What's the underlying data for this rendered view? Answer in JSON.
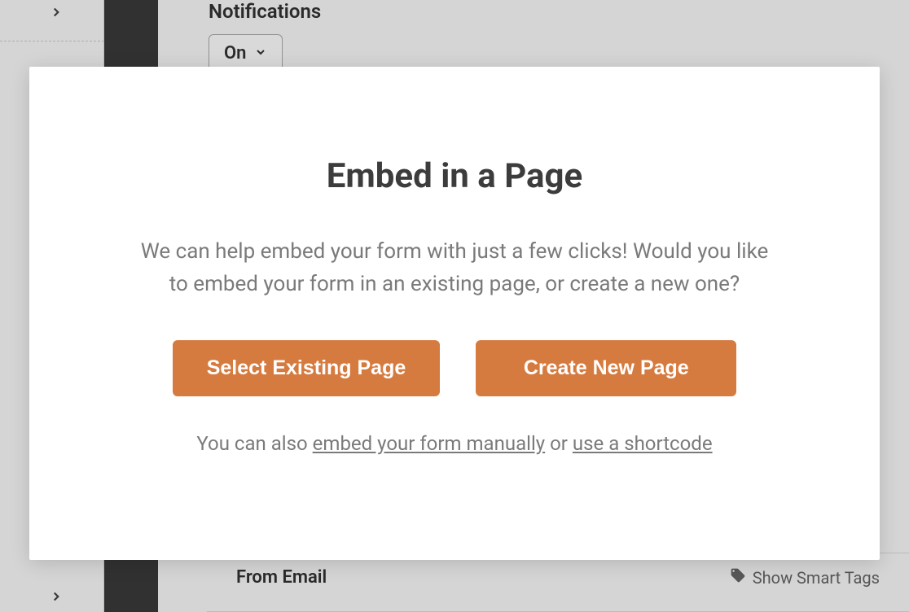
{
  "background": {
    "notifications_label": "Notifications",
    "on_dropdown_value": "On",
    "from_email_label": "From Email",
    "smart_tags_label": "Show Smart Tags"
  },
  "modal": {
    "title": "Embed in a Page",
    "description": "We can help embed your form with just a few clicks! Would you like to embed your form in an existing page, or create a new one?",
    "buttons": {
      "select_existing": "Select Existing Page",
      "create_new": "Create New Page"
    },
    "footer": {
      "prefix": "You can also ",
      "link_manual": "embed your form manually",
      "middle": " or ",
      "link_shortcode": "use a shortcode"
    }
  }
}
